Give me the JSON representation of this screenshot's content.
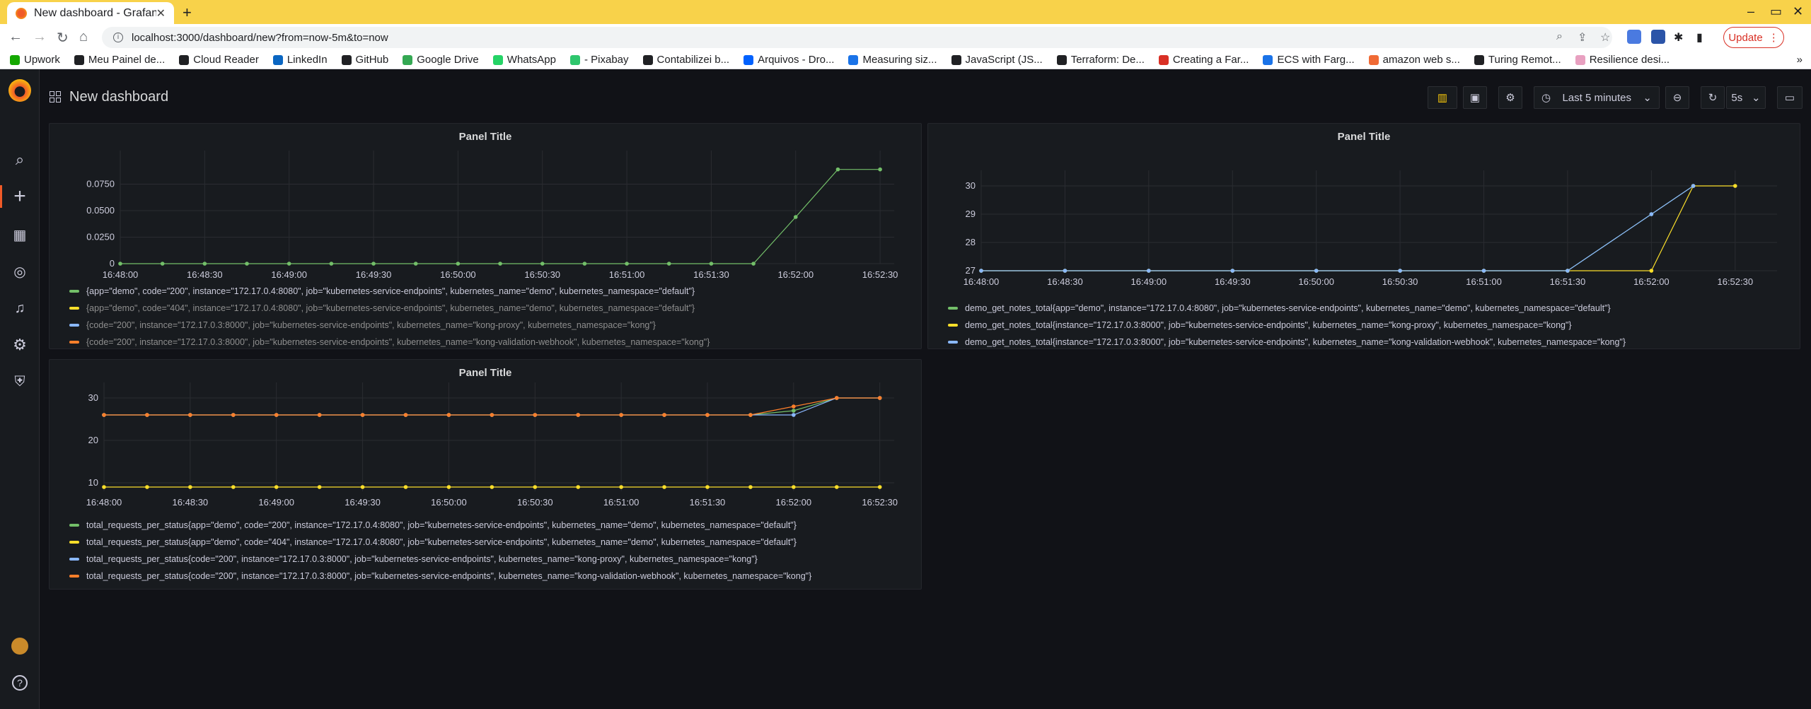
{
  "browser": {
    "tab_title": "New dashboard - Grafana",
    "url": "localhost:3000/dashboard/new?from=now-5m&to=now",
    "update_label": "Update",
    "bookmarks": [
      {
        "label": "Upwork",
        "color": "#14a800"
      },
      {
        "label": "Meu Painel de...",
        "color": "#202124"
      },
      {
        "label": "Cloud Reader",
        "color": "#202124"
      },
      {
        "label": "LinkedIn",
        "color": "#0a66c2"
      },
      {
        "label": "GitHub",
        "color": "#202124"
      },
      {
        "label": "Google Drive",
        "color": "#34a853"
      },
      {
        "label": "WhatsApp",
        "color": "#25d366"
      },
      {
        "label": "- Pixabay",
        "color": "#2ec66d"
      },
      {
        "label": "Contabilizei b...",
        "color": "#202124"
      },
      {
        "label": "Arquivos - Dro...",
        "color": "#0061fe"
      },
      {
        "label": "Measuring siz...",
        "color": "#1a73e8"
      },
      {
        "label": "JavaScript (JS...",
        "color": "#202124"
      },
      {
        "label": "Terraform: De...",
        "color": "#202124"
      },
      {
        "label": "Creating a Far...",
        "color": "#d93025"
      },
      {
        "label": "ECS with Farg...",
        "color": "#1a73e8"
      },
      {
        "label": "amazon web s...",
        "color": "#f06a35"
      },
      {
        "label": "Turing Remot...",
        "color": "#202124"
      },
      {
        "label": "Resilience desi...",
        "color": "#e8a0c0"
      }
    ],
    "bookmarks_more": "»"
  },
  "dashboard": {
    "title": "New dashboard",
    "time_range": "Last 5 minutes",
    "refresh": "5s"
  },
  "panels": [
    {
      "title": "Panel Title",
      "legend": [
        {
          "label": "{app=\"demo\", code=\"200\", instance=\"172.17.0.4:8080\", job=\"kubernetes-service-endpoints\", kubernetes_name=\"demo\", kubernetes_namespace=\"default\"}",
          "color": "#73bf69",
          "dim": false
        },
        {
          "label": "{app=\"demo\", code=\"404\", instance=\"172.17.0.4:8080\", job=\"kubernetes-service-endpoints\", kubernetes_name=\"demo\", kubernetes_namespace=\"default\"}",
          "color": "#fade2a",
          "dim": true
        },
        {
          "label": "{code=\"200\", instance=\"172.17.0.3:8000\", job=\"kubernetes-service-endpoints\", kubernetes_name=\"kong-proxy\", kubernetes_namespace=\"kong\"}",
          "color": "#8ab8ff",
          "dim": true
        },
        {
          "label": "{code=\"200\", instance=\"172.17.0.3:8000\", job=\"kubernetes-service-endpoints\", kubernetes_name=\"kong-validation-webhook\", kubernetes_namespace=\"kong\"}",
          "color": "#ff7f2a",
          "dim": true
        }
      ]
    },
    {
      "title": "Panel Title",
      "legend": [
        {
          "label": "demo_get_notes_total{app=\"demo\", instance=\"172.17.0.4:8080\", job=\"kubernetes-service-endpoints\", kubernetes_name=\"demo\", kubernetes_namespace=\"default\"}",
          "color": "#73bf69",
          "dim": false
        },
        {
          "label": "demo_get_notes_total{instance=\"172.17.0.3:8000\", job=\"kubernetes-service-endpoints\", kubernetes_name=\"kong-proxy\", kubernetes_namespace=\"kong\"}",
          "color": "#fade2a",
          "dim": false
        },
        {
          "label": "demo_get_notes_total{instance=\"172.17.0.3:8000\", job=\"kubernetes-service-endpoints\", kubernetes_name=\"kong-validation-webhook\", kubernetes_namespace=\"kong\"}",
          "color": "#8ab8ff",
          "dim": false
        }
      ]
    },
    {
      "title": "Panel Title",
      "legend": [
        {
          "label": "total_requests_per_status{app=\"demo\", code=\"200\", instance=\"172.17.0.4:8080\", job=\"kubernetes-service-endpoints\", kubernetes_name=\"demo\", kubernetes_namespace=\"default\"}",
          "color": "#73bf69",
          "dim": false
        },
        {
          "label": "total_requests_per_status{app=\"demo\", code=\"404\", instance=\"172.17.0.4:8080\", job=\"kubernetes-service-endpoints\", kubernetes_name=\"demo\", kubernetes_namespace=\"default\"}",
          "color": "#fade2a",
          "dim": false
        },
        {
          "label": "total_requests_per_status{code=\"200\", instance=\"172.17.0.3:8000\", job=\"kubernetes-service-endpoints\", kubernetes_name=\"kong-proxy\", kubernetes_namespace=\"kong\"}",
          "color": "#8ab8ff",
          "dim": false
        },
        {
          "label": "total_requests_per_status{code=\"200\", instance=\"172.17.0.3:8000\", job=\"kubernetes-service-endpoints\", kubernetes_name=\"kong-validation-webhook\", kubernetes_namespace=\"kong\"}",
          "color": "#ff7f2a",
          "dim": false
        }
      ]
    }
  ],
  "chart_data": [
    {
      "type": "line",
      "x_ticks": [
        "16:48:00",
        "16:48:30",
        "16:49:00",
        "16:49:30",
        "16:50:00",
        "16:50:30",
        "16:51:00",
        "16:51:30",
        "16:52:00",
        "16:52:30"
      ],
      "y_ticks": [
        "0",
        "0.0250",
        "0.0500",
        "0.0750"
      ],
      "ylim": [
        0,
        0.1
      ],
      "x": [
        0,
        15,
        30,
        45,
        60,
        75,
        90,
        105,
        120,
        135,
        150,
        165,
        180,
        195,
        210,
        225,
        240,
        255,
        270
      ],
      "series": [
        {
          "color": "#73bf69",
          "values": [
            0,
            0,
            0,
            0,
            0,
            0,
            0,
            0,
            0,
            0,
            0,
            0,
            0,
            0,
            0,
            0,
            0.044,
            0.0889,
            0.0889
          ]
        }
      ]
    },
    {
      "type": "line",
      "x_ticks": [
        "16:48:00",
        "16:48:30",
        "16:49:00",
        "16:49:30",
        "16:50:00",
        "16:50:30",
        "16:51:00",
        "16:51:30",
        "16:52:00",
        "16:52:30"
      ],
      "y_ticks": [
        "27",
        "28",
        "29",
        "30"
      ],
      "ylim": [
        27,
        30.3
      ],
      "series": [
        {
          "color": "#73bf69",
          "x": [
            0,
            30,
            60,
            90,
            120,
            150,
            180,
            210,
            240,
            255
          ],
          "values": [
            27,
            27,
            27,
            27,
            27,
            27,
            27,
            27,
            29,
            30
          ]
        },
        {
          "color": "#fade2a",
          "x": [
            0,
            30,
            60,
            90,
            120,
            150,
            180,
            210,
            240,
            255,
            270
          ],
          "values": [
            27,
            27,
            27,
            27,
            27,
            27,
            27,
            27,
            27,
            30,
            30
          ]
        },
        {
          "color": "#8ab8ff",
          "x": [
            0,
            30,
            60,
            90,
            120,
            150,
            180,
            210,
            240,
            255
          ],
          "values": [
            27,
            27,
            27,
            27,
            27,
            27,
            27,
            27,
            29,
            30
          ]
        }
      ]
    },
    {
      "type": "line",
      "x_ticks": [
        "16:48:00",
        "16:48:30",
        "16:49:00",
        "16:49:30",
        "16:50:00",
        "16:50:30",
        "16:51:00",
        "16:51:30",
        "16:52:00",
        "16:52:30"
      ],
      "y_ticks": [
        "10",
        "20",
        "30"
      ],
      "ylim": [
        8,
        32
      ],
      "x": [
        0,
        15,
        30,
        45,
        60,
        75,
        90,
        105,
        120,
        135,
        150,
        165,
        180,
        195,
        210,
        225,
        240,
        255,
        270
      ],
      "series": [
        {
          "color": "#73bf69",
          "values": [
            26,
            26,
            26,
            26,
            26,
            26,
            26,
            26,
            26,
            26,
            26,
            26,
            26,
            26,
            26,
            26,
            27,
            30,
            30
          ]
        },
        {
          "color": "#fade2a",
          "values": [
            9,
            9,
            9,
            9,
            9,
            9,
            9,
            9,
            9,
            9,
            9,
            9,
            9,
            9,
            9,
            9,
            9,
            9,
            9
          ]
        },
        {
          "color": "#8ab8ff",
          "values": [
            26,
            26,
            26,
            26,
            26,
            26,
            26,
            26,
            26,
            26,
            26,
            26,
            26,
            26,
            26,
            26,
            26,
            30,
            30
          ]
        },
        {
          "color": "#ff7f2a",
          "values": [
            26,
            26,
            26,
            26,
            26,
            26,
            26,
            26,
            26,
            26,
            26,
            26,
            26,
            26,
            26,
            26,
            28,
            30,
            30
          ]
        }
      ]
    }
  ]
}
